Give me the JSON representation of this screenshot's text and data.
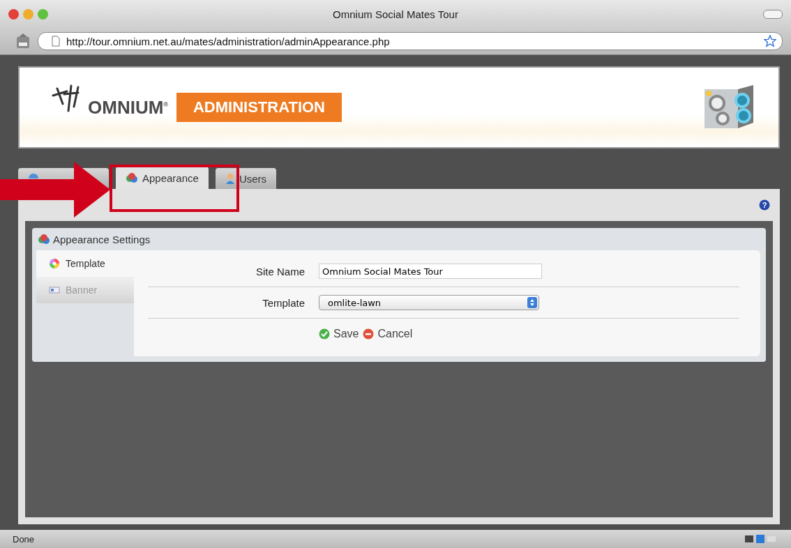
{
  "window": {
    "title": "Omnium Social Mates Tour"
  },
  "address_bar": {
    "url": "http://tour.omnium.net.au/mates/administration/adminAppearance.php"
  },
  "banner": {
    "logo": "OMNIUM",
    "registered": "®",
    "section": "ADMINISTRATION"
  },
  "tabs": [
    {
      "selected": false,
      "kind": "globe"
    },
    {
      "label": "Appearance",
      "selected": true,
      "kind": "appearance"
    },
    {
      "label": "Users",
      "selected": false,
      "kind": "user"
    }
  ],
  "help": {
    "icon": "?"
  },
  "panel": {
    "title": "Appearance Settings",
    "side_tabs": [
      {
        "label": "Template",
        "selected": true,
        "kind": "wheel"
      },
      {
        "label": "Banner",
        "selected": false,
        "kind": "banner"
      }
    ],
    "fields": [
      {
        "label": "Site Name",
        "kind": "text",
        "value": "Omnium Social Mates Tour"
      },
      {
        "label": "Template",
        "kind": "select",
        "value": "omlite-lawn"
      }
    ],
    "buttons": [
      {
        "label": "Save",
        "kind": "ok"
      },
      {
        "label": "Cancel",
        "kind": "cancel"
      }
    ]
  },
  "status_bar": {
    "text": "Done"
  }
}
